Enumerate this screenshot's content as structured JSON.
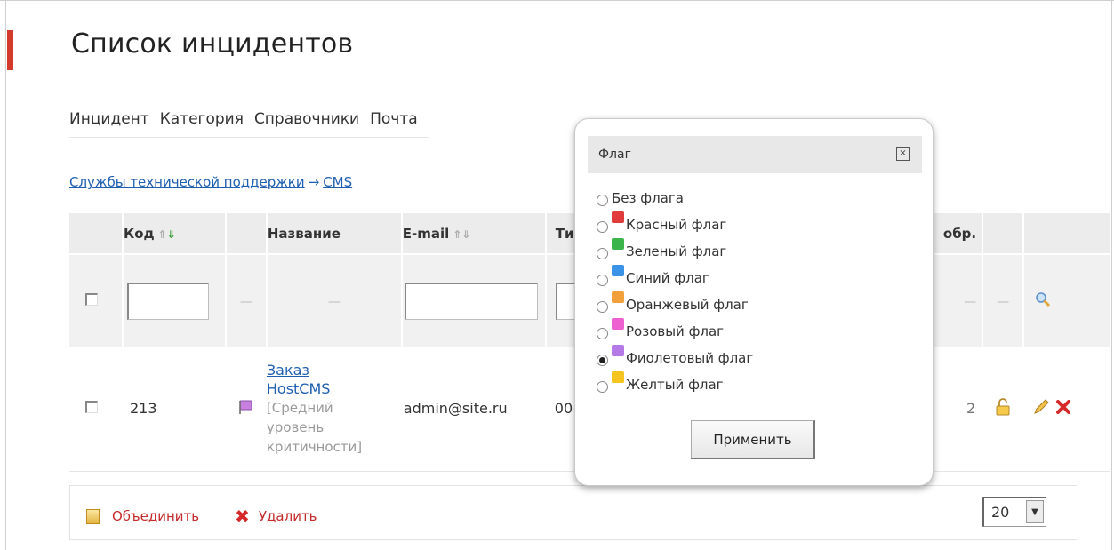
{
  "page": {
    "title": "Список инцидентов",
    "menu": [
      "Инцидент",
      "Категория",
      "Справочники",
      "Почта"
    ],
    "breadcrumb": {
      "parent": "Службы технической поддержки",
      "arrow": "→",
      "current": "CMS"
    }
  },
  "table": {
    "headers": {
      "code": "Код",
      "name": "Название",
      "email": "E-mail",
      "type": "Ти",
      "date": "обр."
    },
    "filter_dash": "—",
    "rows": [
      {
        "code": "213",
        "flag_color": "#c77fe0",
        "title": "Заказ HostCMS",
        "title_line1": "Заказ",
        "title_line2": "HostCMS",
        "level_line1": "[Средний",
        "level_line2": "уровень",
        "level_line3": "критичности]",
        "email": "admin@site.ru",
        "type_partial": "00",
        "date_partial": "2"
      }
    ]
  },
  "footer": {
    "merge_label": "Объединить",
    "delete_label": "Удалить",
    "page_size": "20",
    "dropdown_arrow": "▼"
  },
  "popup": {
    "title": "Флаг",
    "close": "×",
    "options": [
      {
        "label": "Без флага",
        "color": null,
        "selected": false
      },
      {
        "label": "Красный флаг",
        "color": "#e23b3b",
        "selected": false
      },
      {
        "label": "Зеленый флаг",
        "color": "#3bb54a",
        "selected": false
      },
      {
        "label": "Синий флаг",
        "color": "#3a93e6",
        "selected": false
      },
      {
        "label": "Оранжевый флаг",
        "color": "#f2a03c",
        "selected": false
      },
      {
        "label": "Розовый флаг",
        "color": "#ee5fcf",
        "selected": false
      },
      {
        "label": "Фиолетовый флаг",
        "color": "#b57ae6",
        "selected": true
      },
      {
        "label": "Желтый флаг",
        "color": "#f6c41e",
        "selected": false
      }
    ],
    "apply_label": "Применить"
  },
  "colors": {
    "accent": "#d33a2c",
    "link": "#1f5fb0",
    "danger": "#c42b2b"
  }
}
